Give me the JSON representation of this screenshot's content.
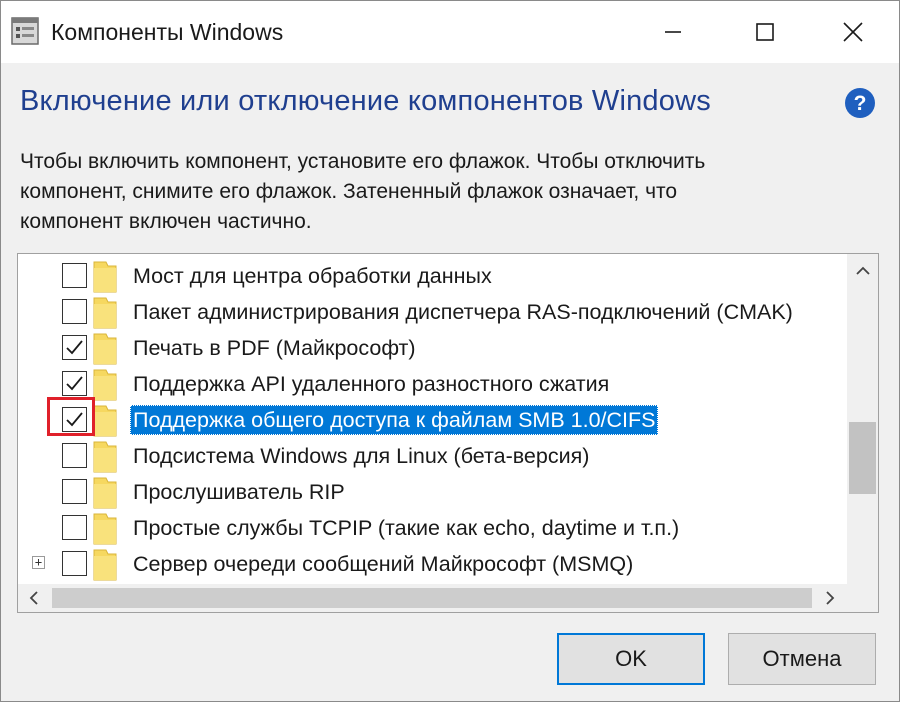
{
  "window": {
    "title": "Компоненты Windows",
    "controls": {
      "minimize": "minimize",
      "maximize": "maximize",
      "close": "close"
    }
  },
  "header": {
    "heading": "Включение или отключение компонентов Windows",
    "help_icon": "help-icon",
    "description_lines": [
      "Чтобы включить компонент, установите его флажок. Чтобы отключить",
      "компонент, снимите его флажок. Затененный флажок означает, что",
      "компонент включен частично."
    ]
  },
  "features": [
    {
      "label": "Мост для центра обработки данных",
      "checked": false,
      "selected": false,
      "expandable": false
    },
    {
      "label": "Пакет администрирования диспетчера RAS-подключений (CMAK)",
      "checked": false,
      "selected": false,
      "expandable": false
    },
    {
      "label": "Печать в PDF (Майкрософт)",
      "checked": true,
      "selected": false,
      "expandable": false
    },
    {
      "label": "Поддержка API удаленного разностного сжатия",
      "checked": true,
      "selected": false,
      "expandable": false
    },
    {
      "label": "Поддержка общего доступа к файлам SMB 1.0/CIFS",
      "checked": true,
      "selected": true,
      "expandable": false
    },
    {
      "label": "Подсистема Windows для Linux (бета-версия)",
      "checked": false,
      "selected": false,
      "expandable": false
    },
    {
      "label": "Прослушиватель RIP",
      "checked": false,
      "selected": false,
      "expandable": false
    },
    {
      "label": "Простые службы TCPIP (такие как echo, daytime и т.п.)",
      "checked": false,
      "selected": false,
      "expandable": false
    },
    {
      "label": "Сервер очереди сообщений Майкрософт (MSMQ)",
      "checked": false,
      "selected": false,
      "expandable": true
    }
  ],
  "buttons": {
    "ok": "OK",
    "cancel": "Отмена"
  },
  "colors": {
    "heading": "#1f3f8f",
    "selection": "#0078d7",
    "highlight_box": "#e0202a",
    "folder": "#f6d860"
  }
}
